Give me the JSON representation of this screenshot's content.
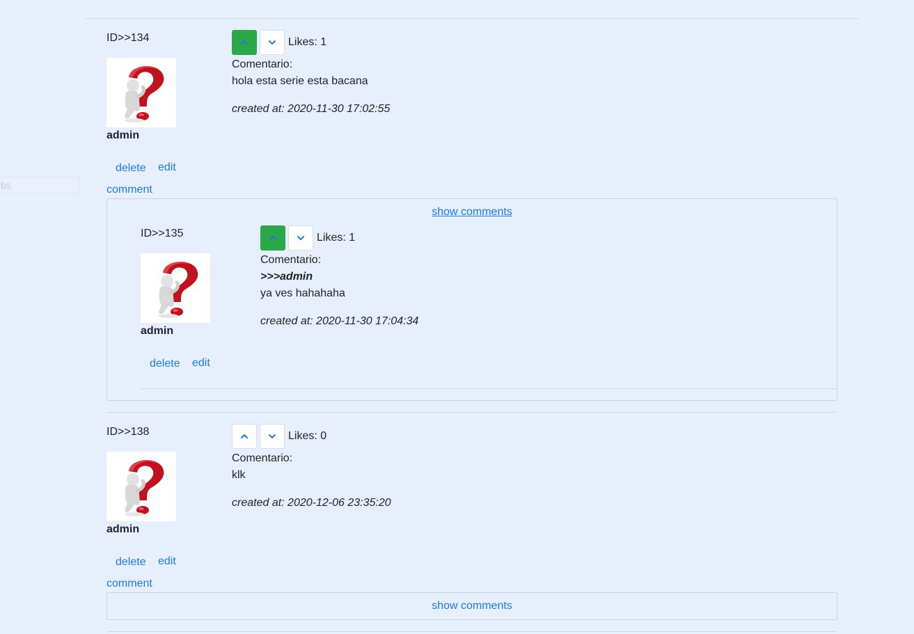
{
  "side_input": {
    "placeholder": "bs"
  },
  "comments": [
    {
      "id_label": "ID>>134",
      "author": "admin",
      "likes": "Likes: 1",
      "upvoted": true,
      "comment_label": "Comentario:",
      "text": "hola esta serie esta bacana",
      "created": "created at: 2020-11-30 17:02:55",
      "delete_label": "delete",
      "edit_label": "edit",
      "comment_label_link": "comment",
      "show_comments_label": "show comments",
      "replies": [
        {
          "id_label": "ID>>135",
          "author": "admin",
          "likes": "Likes: 1",
          "upvoted": true,
          "comment_label": "Comentario:",
          "mention": ">>>admin",
          "text": "ya ves hahahaha",
          "created": "created at: 2020-11-30 17:04:34",
          "delete_label": "delete",
          "edit_label": "edit"
        }
      ]
    },
    {
      "id_label": "ID>>138",
      "author": "admin",
      "likes": "Likes: 0",
      "upvoted": false,
      "comment_label": "Comentario:",
      "text": "klk",
      "created": "created at: 2020-12-06 23:35:20",
      "delete_label": "delete",
      "edit_label": "edit",
      "comment_label_link": "comment",
      "show_comments_label": "show comments"
    }
  ],
  "colors": {
    "background": "#e7eefc",
    "upvote_active": "#2aa84a",
    "link": "#1a7be0",
    "chevron": "#1a7be0"
  },
  "icons": {
    "upvote": "chevron-up-icon",
    "downvote": "chevron-down-icon",
    "avatar": "question-mark-person-icon"
  }
}
